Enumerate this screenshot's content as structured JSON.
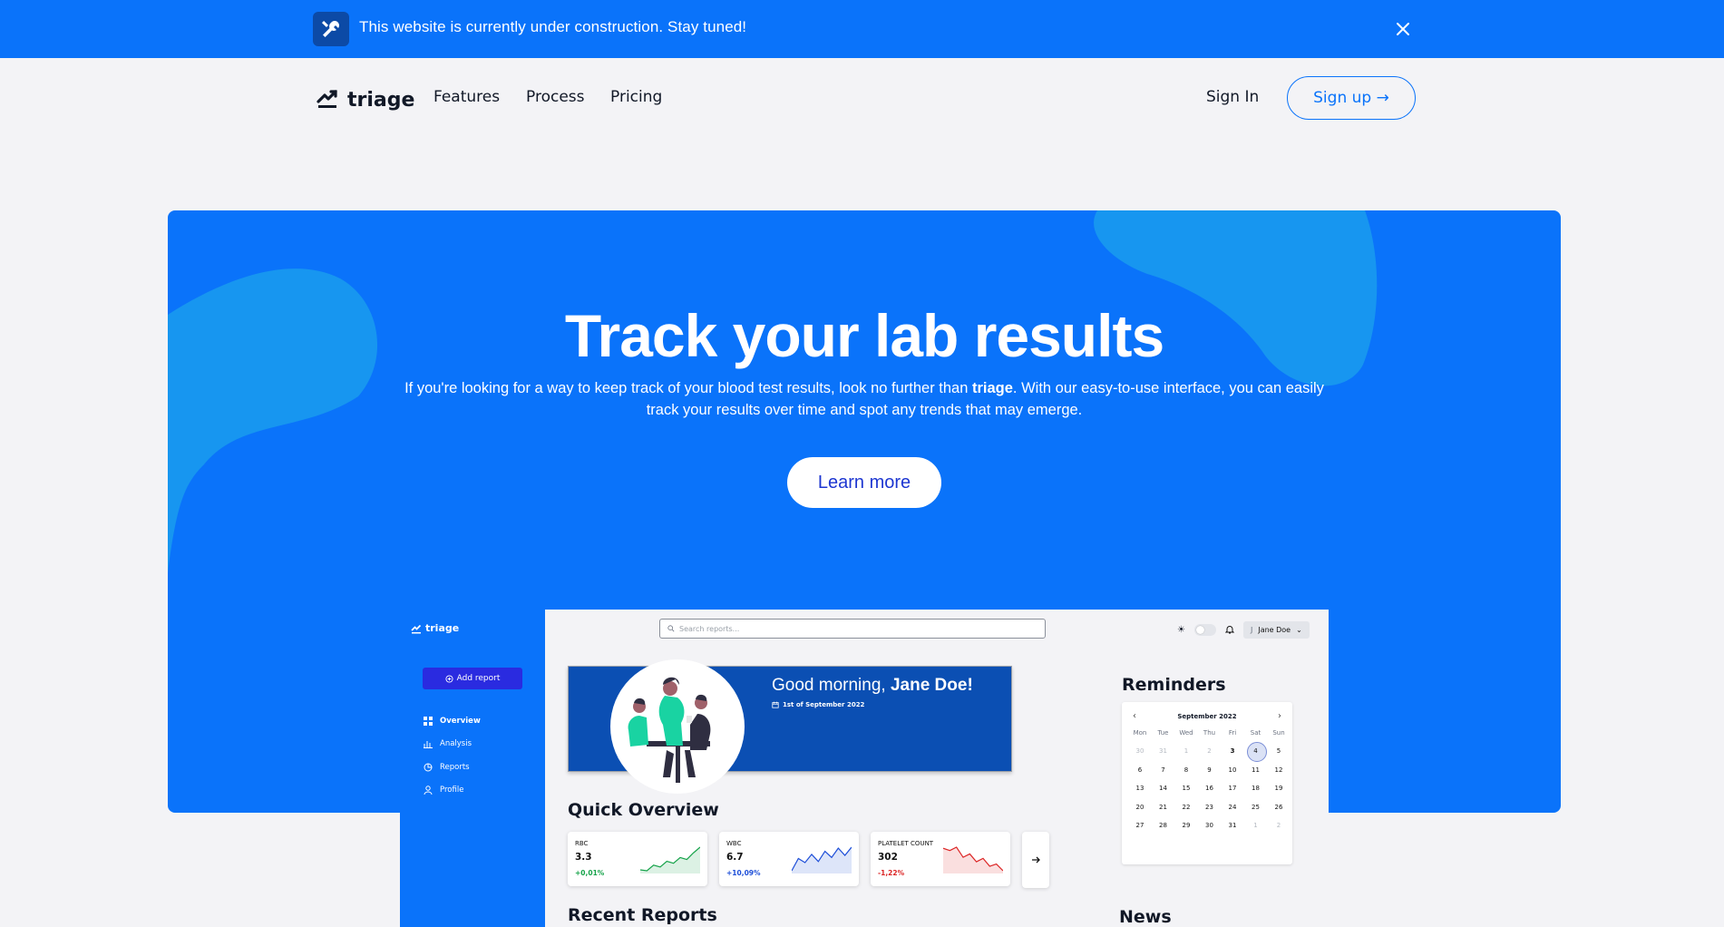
{
  "banner": {
    "text": "This website is currently under construction. Stay tuned!",
    "icon": "tools-icon",
    "close_icon": "close-icon"
  },
  "nav": {
    "brand": "triage",
    "links": [
      "Features",
      "Process",
      "Pricing"
    ],
    "sign_in": "Sign In",
    "sign_up": "Sign up →"
  },
  "hero": {
    "title": "Track your lab results",
    "desc_before": "If you're looking for a way to keep track of your blood test results, look no further than ",
    "desc_brand": "triage",
    "desc_after": ". With our easy-to-use interface, you can easily track your results over time and spot any trends that may emerge.",
    "cta": "Learn more"
  },
  "app": {
    "brand": "triage",
    "add_report": "Add report",
    "sidebar": [
      {
        "label": "Overview",
        "icon": "grid-icon"
      },
      {
        "label": "Analysis",
        "icon": "bar-chart-icon"
      },
      {
        "label": "Reports",
        "icon": "report-icon"
      },
      {
        "label": "Profile",
        "icon": "user-icon"
      }
    ],
    "search_placeholder": "Search reports...",
    "user_initial": "J",
    "user_name": "Jane Doe",
    "greeting_prefix": "Good morning, ",
    "greeting_name": "Jane Doe!",
    "date": "1st of September 2022",
    "quick_overview": "Quick Overview",
    "recent_reports": "Recent Reports",
    "reminders": "Reminders",
    "news": "News",
    "quick_cards": [
      {
        "label": "RBC",
        "value": "3.3",
        "change": "+0,01%",
        "color": "#16a34a",
        "values": [
          2.1,
          2.0,
          2.6,
          2.4,
          3.0,
          2.8,
          3.4,
          3.2,
          3.9,
          4.5
        ]
      },
      {
        "label": "WBC",
        "value": "6.7",
        "change": "+10,09%",
        "color": "#1d4ed8",
        "values": [
          5.0,
          6.2,
          5.8,
          6.6,
          5.9,
          6.9,
          6.3,
          7.2,
          6.5,
          7.3
        ]
      },
      {
        "label": "PLATELET COUNT",
        "value": "302",
        "change": "-1,22%",
        "color": "#dc2626",
        "values": [
          320,
          318,
          321,
          312,
          315,
          308,
          311,
          304,
          306,
          300
        ]
      }
    ],
    "calendar": {
      "month": "September 2022",
      "dow": [
        "Mon",
        "Tue",
        "Wed",
        "Thu",
        "Fri",
        "Sat",
        "Sun"
      ],
      "weeks": [
        [
          "30",
          "31",
          "1",
          "2",
          "3",
          "4",
          "5"
        ],
        [
          "6",
          "7",
          "8",
          "9",
          "10",
          "11",
          "12"
        ],
        [
          "13",
          "14",
          "15",
          "16",
          "17",
          "18",
          "19"
        ],
        [
          "20",
          "21",
          "22",
          "23",
          "24",
          "25",
          "26"
        ],
        [
          "27",
          "28",
          "29",
          "30",
          "31",
          "1",
          "2"
        ]
      ],
      "selected": "4"
    }
  },
  "colors": {
    "primary": "#0a73fa",
    "banner_icon_bg": "#0c4aa6",
    "card_blue": "#0b4fb3",
    "add_btn": "#2a2be0",
    "blob": "#1796f0"
  }
}
